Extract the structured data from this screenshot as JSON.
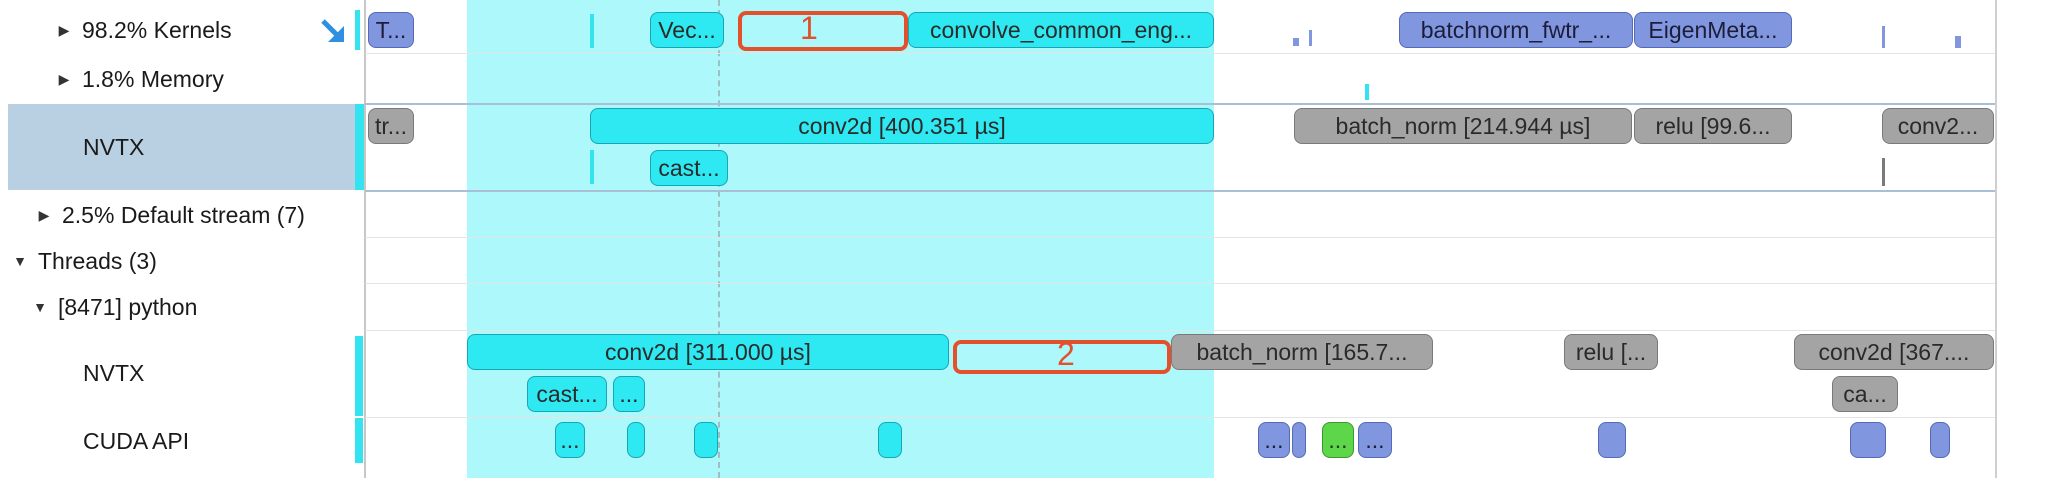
{
  "sidebar": {
    "rows": [
      {
        "expander": "collapsed",
        "label": "98.2% Kernels"
      },
      {
        "expander": "collapsed",
        "label": "1.8% Memory"
      },
      {
        "expander": "none",
        "label": "NVTX"
      },
      {
        "expander": "collapsed",
        "label": "2.5% Default stream (7)"
      },
      {
        "expander": "expanded",
        "label": "Threads (3)"
      },
      {
        "expander": "expanded",
        "label": "[8471] python"
      },
      {
        "expander": "none",
        "label": "NVTX"
      },
      {
        "expander": "none",
        "label": "CUDA API"
      }
    ],
    "icons": {
      "kernels_arrow": "diagonal-arrow-icon"
    }
  },
  "timeline": {
    "kernels_row": {
      "blocks": [
        "T...",
        "Vec...",
        "convolve_common_eng...",
        "batchnorm_fwtr_...",
        "EigenMeta..."
      ]
    },
    "gpu_nvtx_row": {
      "blocks": [
        "tr...",
        "conv2d [400.351 µs]",
        "cast...",
        "batch_norm [214.944 µs]",
        "relu [99.6...",
        "conv2..."
      ]
    },
    "thread_nvtx_row": {
      "blocks": [
        "conv2d [311.000 µs]",
        "cast...",
        "...",
        "batch_norm [165.7...",
        "relu [...",
        "conv2d [367....",
        "ca..."
      ]
    },
    "cuda_api_row": {
      "blocks": [
        "...",
        "...",
        "...",
        "..."
      ]
    }
  },
  "annotations": [
    {
      "label": "1"
    },
    {
      "label": "2"
    }
  ],
  "colors": {
    "selection_highlight": "#adf8fb",
    "nvtx_cyan": "#2ee9f2",
    "kernel_blue": "#8097df",
    "nvtx_gray": "#a4a4a4",
    "cuda_green": "#5ed64a",
    "annotation_red": "#e2512b",
    "sidebar_selected": "#b9cfe2"
  }
}
